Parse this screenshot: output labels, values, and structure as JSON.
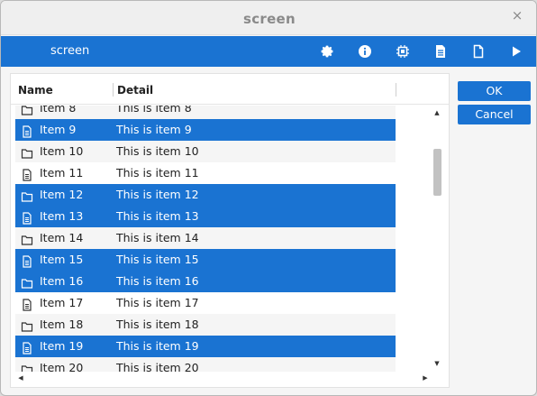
{
  "window": {
    "title": "screen",
    "close_glyph": "×"
  },
  "toolbar": {
    "label": "screen",
    "icons": [
      "gear-icon",
      "info-icon",
      "chip-icon",
      "document-text-icon",
      "document-icon",
      "play-icon"
    ]
  },
  "table": {
    "headers": {
      "name": "Name",
      "detail": "Detail"
    },
    "rows": [
      {
        "name": "Item 8",
        "detail": "This is item 8",
        "icon": "folder-icon",
        "selected": false
      },
      {
        "name": "Item 9",
        "detail": "This is item 9",
        "icon": "document-icon",
        "selected": true
      },
      {
        "name": "Item 10",
        "detail": "This is item 10",
        "icon": "folder-icon",
        "selected": false
      },
      {
        "name": "Item 11",
        "detail": "This is item 11",
        "icon": "document-icon",
        "selected": false
      },
      {
        "name": "Item 12",
        "detail": "This is item 12",
        "icon": "folder-icon",
        "selected": true
      },
      {
        "name": "Item 13",
        "detail": "This is item 13",
        "icon": "document-icon",
        "selected": true
      },
      {
        "name": "Item 14",
        "detail": "This is item 14",
        "icon": "folder-icon",
        "selected": false
      },
      {
        "name": "Item 15",
        "detail": "This is item 15",
        "icon": "document-icon",
        "selected": true
      },
      {
        "name": "Item 16",
        "detail": "This is item 16",
        "icon": "folder-icon",
        "selected": true
      },
      {
        "name": "Item 17",
        "detail": "This is item 17",
        "icon": "document-icon",
        "selected": false
      },
      {
        "name": "Item 18",
        "detail": "This is item 18",
        "icon": "folder-icon",
        "selected": false
      },
      {
        "name": "Item 19",
        "detail": "This is item 19",
        "icon": "document-icon",
        "selected": true
      },
      {
        "name": "Item 20",
        "detail": "This is item 20",
        "icon": "folder-icon",
        "selected": false
      }
    ]
  },
  "buttons": {
    "ok": "OK",
    "cancel": "Cancel"
  },
  "colors": {
    "accent": "#1a73d2",
    "alt_row": "#f5f5f5"
  }
}
